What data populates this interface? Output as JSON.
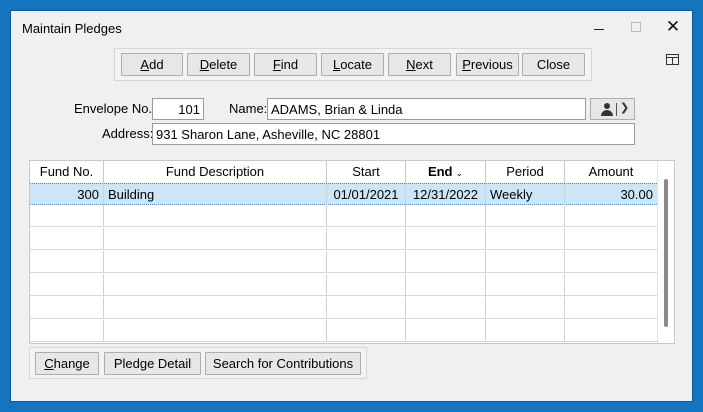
{
  "window": {
    "title": "Maintain Pledges",
    "close_glyph": "✕"
  },
  "toolbar": {
    "add": {
      "u": "A",
      "rest": "dd"
    },
    "delete": {
      "u": "D",
      "rest": "elete"
    },
    "find": {
      "u": "F",
      "rest": "ind"
    },
    "locate": {
      "u": "L",
      "rest": "ocate"
    },
    "next": {
      "u": "N",
      "rest": "ext"
    },
    "previous": {
      "u": "P",
      "rest": "revious"
    },
    "close": "Close"
  },
  "form": {
    "envelope_label": "Envelope No.:",
    "envelope_value": "101",
    "name_label": "Name:",
    "name_value": "ADAMS, Brian & Linda",
    "address_label": "Address:",
    "address_value": "931 Sharon Lane, Asheville, NC 28801"
  },
  "icons": {
    "person": "person-icon",
    "chevron": "chevron-down-icon",
    "layout": "layout-icon",
    "sort_glyph": "⌄"
  },
  "grid": {
    "headers": {
      "fund_no": "Fund No.",
      "fund_desc": "Fund Description",
      "start": "Start",
      "end": "End",
      "period": "Period",
      "amount": "Amount"
    },
    "rows": [
      {
        "fund_no": "300",
        "fund_desc": "Building",
        "start": "01/01/2021",
        "end": "12/31/2022",
        "period": "Weekly",
        "amount": "30.00"
      }
    ]
  },
  "bottom": {
    "change": {
      "u": "C",
      "rest": "hange"
    },
    "pledge_detail": "Pledge Detail",
    "search_contrib": "Search for Contributions"
  },
  "colors": {
    "border": "#1574be",
    "selected_row": "#cde6f7",
    "window_bg": "#f0f0f0"
  }
}
